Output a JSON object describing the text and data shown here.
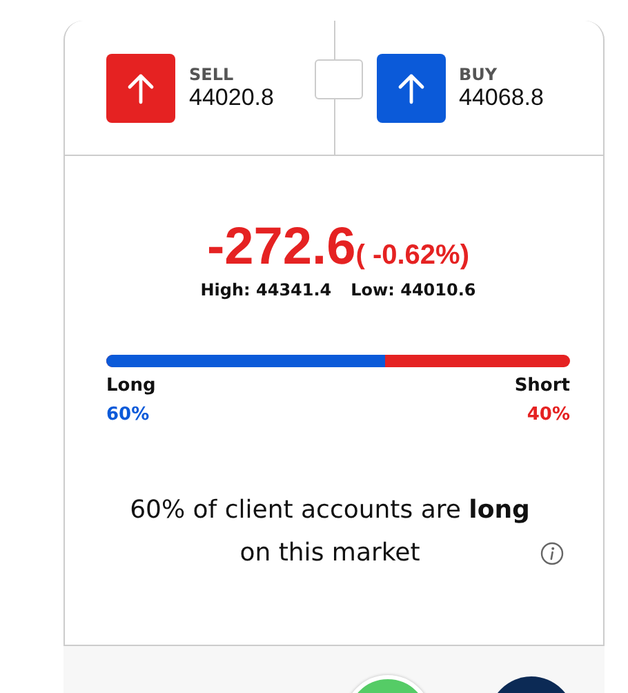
{
  "quotes": [
    {
      "kind": "sell",
      "label": "SELL",
      "price": "44020.8"
    },
    {
      "kind": "buy",
      "label": "BUY",
      "price": "44068.8"
    }
  ],
  "change": {
    "value": "-272.6",
    "percent": "( -0.62%)"
  },
  "range": {
    "high": "High: 44341.4",
    "low": "Low: 44010.6"
  },
  "sentiment": {
    "level": 0.6,
    "long_label": "Long",
    "short_label": "Short",
    "long_percent": "60%",
    "short_percent": "40%"
  },
  "summary": "60% of client accounts are **long** on this market"
}
